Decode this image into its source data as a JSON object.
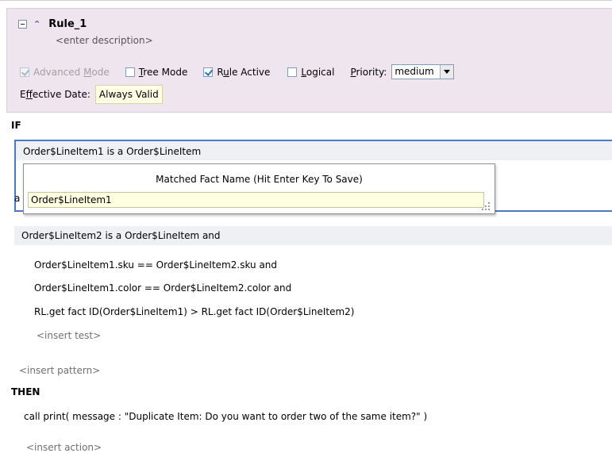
{
  "rule": {
    "name": "Rule_1",
    "description_placeholder": "<enter description>",
    "options": {
      "advanced_mode": {
        "label_pre": "Advanced ",
        "label_key": "M",
        "label_post": "ode",
        "checked": true,
        "enabled": false
      },
      "tree_mode": {
        "label_pre": "",
        "label_key": "T",
        "label_post": "ree Mode",
        "checked": false
      },
      "rule_active": {
        "label_pre": "R",
        "label_key": "u",
        "label_post": "le Active",
        "checked": true
      },
      "logical": {
        "label_pre": "",
        "label_key": "L",
        "label_post": "ogical",
        "checked": false
      },
      "priority": {
        "label_pre": "",
        "label_key": "P",
        "label_post": "riority:",
        "value": "medium"
      }
    },
    "effective_date": {
      "label_pre": "E",
      "label_key": "f",
      "label_post": "fective Date:",
      "value": "Always Valid"
    }
  },
  "if_section": {
    "keyword": "IF",
    "pattern1": "Order$LineItem1 is a Order$LineItem",
    "popup": {
      "title": "Matched Fact Name (Hit Enter Key To Save)",
      "value": "Order$LineItem1"
    },
    "hidden_char": "a",
    "pattern2": "Order$LineItem2 is a Order$LineItem  and",
    "tests": [
      "Order$LineItem1.sku  ==  Order$LineItem2.sku and",
      "Order$LineItem1.color  ==  Order$LineItem2.color and",
      "RL.get fact ID(Order$LineItem1)  >  RL.get fact ID(Order$LineItem2)"
    ],
    "insert_test": "<insert test>",
    "insert_pattern": "<insert pattern>"
  },
  "then_section": {
    "keyword": "THEN",
    "action": "call print( message : \"Duplicate Item: Do you want to order two of the same item?\" )",
    "insert_action": "<insert action>"
  },
  "colors": {
    "accent": "#4d78c9",
    "panel": "#efe5ef",
    "input_bg": "#ffffe1"
  },
  "icons": [
    "collapse-box-icon",
    "chevron-up-icon",
    "dropdown-arrow-icon",
    "resize-grip-icon"
  ]
}
